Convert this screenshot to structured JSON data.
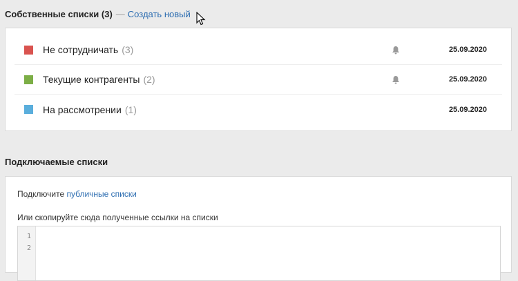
{
  "own_lists": {
    "title": "Собственные списки (3)",
    "dash": "—",
    "create_link": "Создать новый",
    "items": [
      {
        "name": "Не сотрудничать",
        "count": "(3)",
        "color": "#d9534f",
        "notify": true,
        "date": "25.09.2020"
      },
      {
        "name": "Текущие контрагенты",
        "count": "(2)",
        "color": "#7cae46",
        "notify": true,
        "date": "25.09.2020"
      },
      {
        "name": "На рассмотрении",
        "count": "(1)",
        "color": "#5aaedc",
        "notify": false,
        "date": "25.09.2020"
      }
    ]
  },
  "connected_lists": {
    "title": "Подключаемые списки",
    "connect_prefix": "Подключите",
    "public_link": "публичные списки",
    "paste_hint": "Или скопируйте сюда полученные ссылки на списки",
    "editor_line_numbers": [
      "1",
      "2"
    ]
  },
  "icons": {
    "bell": "bell-icon",
    "cursor": "mouse-pointer-icon"
  }
}
